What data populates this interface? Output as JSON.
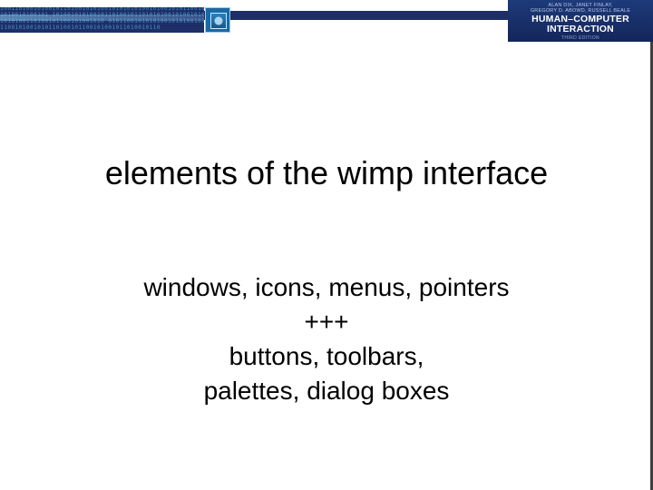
{
  "banner": {
    "book": {
      "authors": "ALAN DIX, JANET FINLAY,\nGREGORY D. ABOWD, RUSSELL BEALE",
      "title_line1": "HUMAN–COMPUTER",
      "title_line2": "INTERACTION",
      "edition": "THIRD EDITION"
    }
  },
  "slide": {
    "title": "elements of the wimp interface",
    "body": {
      "line1": "windows, icons, menus, pointers",
      "line2": "+++",
      "line3": "buttons, toolbars,",
      "line4": "palettes, dialog boxes"
    }
  }
}
